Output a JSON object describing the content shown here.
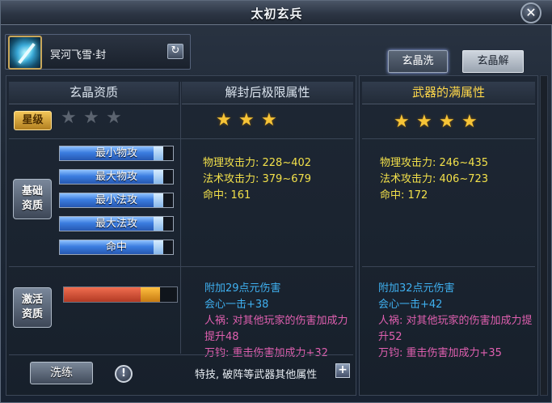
{
  "window": {
    "title": "太初玄兵",
    "close_icon": "close-icon"
  },
  "weapon": {
    "name": "冥河飞雪·封",
    "icon": "sword-weapon-icon",
    "refresh_icon": "refresh-icon"
  },
  "tabs": [
    {
      "label": "玄晶洗练",
      "active": true
    },
    {
      "label": "玄晶解封",
      "active": false
    }
  ],
  "headers": {
    "left": "玄晶资质",
    "middle": "解封后极限属性",
    "right": "武器的满属性"
  },
  "grade": {
    "label": "星级",
    "current_stars": 0,
    "current_max": 3,
    "unsealed_stars": 3,
    "full_stars": 4
  },
  "basic": {
    "button": "基础\n资质",
    "stats": [
      {
        "label": "最小物攻",
        "fill": 0.9
      },
      {
        "label": "最大物攻",
        "fill": 0.9
      },
      {
        "label": "最小法攻",
        "fill": 0.9
      },
      {
        "label": "最大法攻",
        "fill": 0.9
      },
      {
        "label": "命中",
        "fill": 0.9
      }
    ]
  },
  "unsealed_attrs": [
    "物理攻击力: 228~402",
    "法术攻击力: 379~679",
    "命中: 161"
  ],
  "full_attrs": [
    "物理攻击力: 246~435",
    "法术攻击力: 406~723",
    "命中: 172"
  ],
  "activate": {
    "button": "激活\n资质",
    "red_fill": 0.68,
    "orange_fill": 0.17
  },
  "unsealed_special": {
    "line1": "附加29点元伤害",
    "line2": "会心一击+38",
    "line3": "人祸: 对其他玩家的伤害加成力提升48",
    "line4": "万钧: 重击伤害加成力+32"
  },
  "full_special": {
    "line1": "附加32点元伤害",
    "line2": "会心一击+42",
    "line3": "人祸: 对其他玩家的伤害加成力提升52",
    "line4": "万钧: 重击伤害加成力+35"
  },
  "footer": {
    "wash_button": "洗练",
    "info_icon": "info-icon",
    "other_attrs_label": "特技, 破阵等武器其他属性",
    "plus_icon": "plus-icon"
  },
  "colors": {
    "gold_star": "#f7c437",
    "header_yellow": "#ffd84a",
    "attr_yellow": "#f2e04a",
    "attr_blue": "#3fb0f0",
    "attr_pink": "#e060b0"
  }
}
